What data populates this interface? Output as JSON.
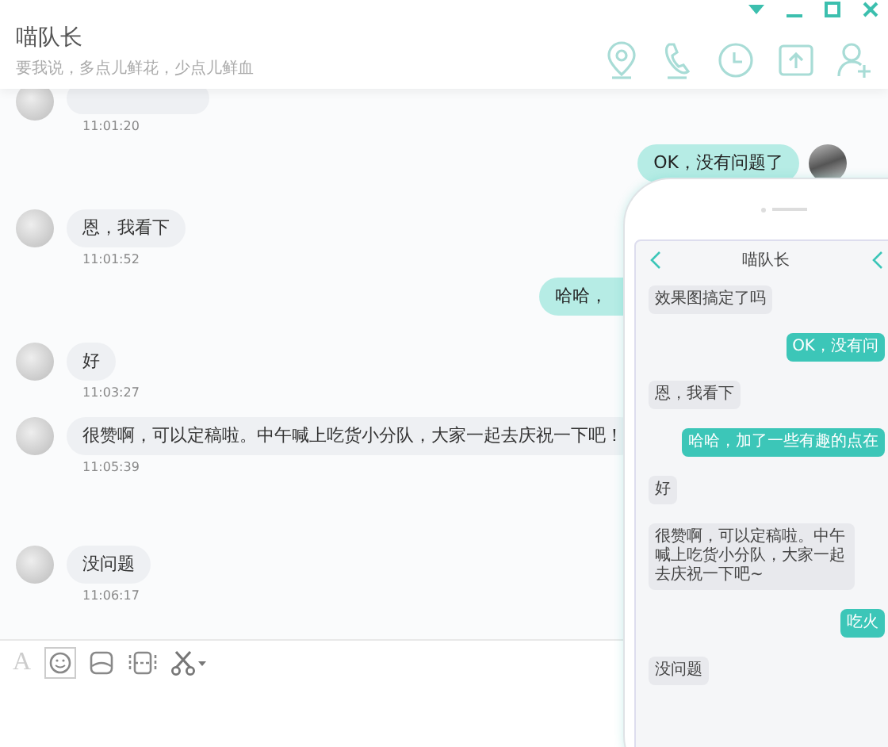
{
  "window": {
    "title": "喵队长",
    "subtitle": "要我说，多点儿鲜花，少点儿鲜血"
  },
  "messages": [
    {
      "kind": "incoming",
      "time": "11:01:20"
    },
    {
      "kind": "outgoing",
      "text": "OK，没有问题了"
    },
    {
      "kind": "incoming",
      "text": "恩，我看下",
      "time": "11:01:52"
    },
    {
      "kind": "outgoing",
      "text": "哈哈，"
    },
    {
      "kind": "incoming",
      "text": "好",
      "time": "11:03:27"
    },
    {
      "kind": "incoming",
      "text": "很赞啊，可以定稿啦。中午喊上吃货小分队，大家一起去庆祝一下吧！",
      "time": "11:05:39"
    },
    {
      "kind": "incoming",
      "text": "没问题",
      "time": "11:06:17"
    }
  ],
  "toolbar": {
    "font_label": "A"
  },
  "phone": {
    "title": "喵队长",
    "messages": [
      {
        "kind": "incoming",
        "text": "效果图搞定了吗"
      },
      {
        "kind": "outgoing",
        "text": "OK，没有问"
      },
      {
        "kind": "incoming",
        "text": "恩，我看下"
      },
      {
        "kind": "outgoing",
        "text": "哈哈，加了一些有趣的点在"
      },
      {
        "kind": "incoming",
        "text": "好"
      },
      {
        "kind": "incoming",
        "text": "很赞啊，可以定稿啦。中午喊上吃货小分队，大家一起去庆祝一下吧~"
      },
      {
        "kind": "outgoing",
        "text": "吃火"
      },
      {
        "kind": "incoming",
        "text": "没问题"
      }
    ]
  }
}
